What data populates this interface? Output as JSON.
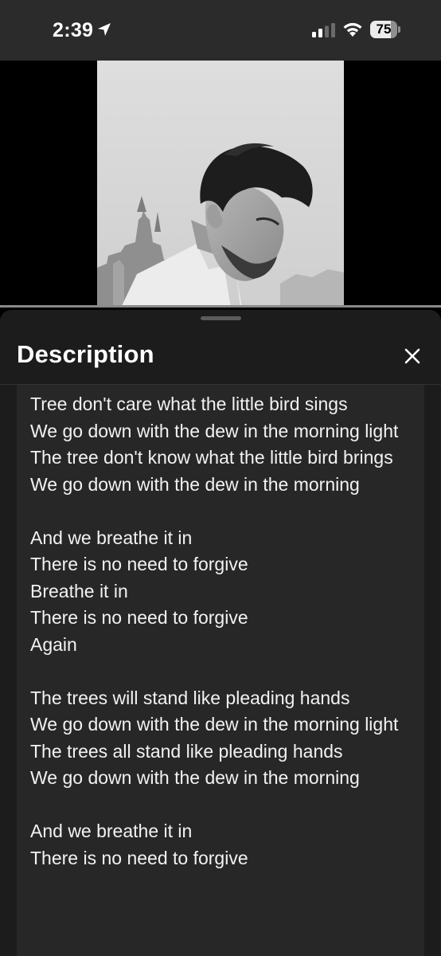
{
  "status_bar": {
    "time": "2:39",
    "battery_level": "75",
    "battery_fraction": 0.75
  },
  "video": {
    "thumbnail": "man-portrait-black-and-white"
  },
  "sheet": {
    "title": "Description",
    "close_icon": "close-icon"
  },
  "description": {
    "lines": [
      "Tree don't care what the little bird sings",
      "We go down with the dew in the morning light",
      "The tree don't know what the little bird brings",
      "We go down with the dew in the morning",
      "",
      "And we breathe it in",
      "There is no need to forgive",
      "Breathe it in",
      "There is no need to forgive",
      "Again",
      "",
      "The trees will stand like pleading hands",
      "We go down with the dew in the morning light",
      "The trees all stand like pleading hands",
      "We go down with the dew in the morning",
      "",
      "And we breathe it in",
      "There is no need to forgive"
    ]
  },
  "colors": {
    "status_bar_bg": "#2b2b2b",
    "sheet_bg": "#1c1c1c",
    "card_bg": "#272727",
    "text": "#f2f2f2"
  }
}
